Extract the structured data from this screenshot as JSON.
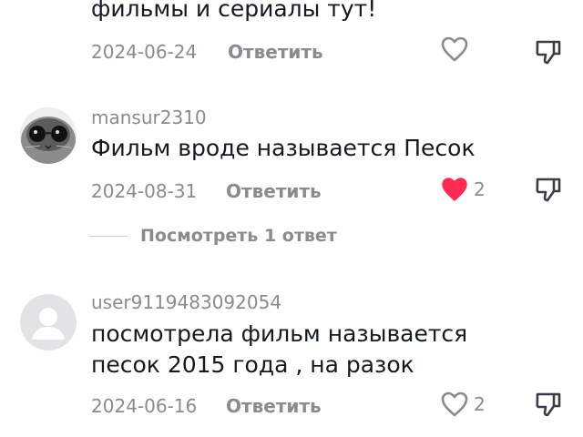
{
  "comments": [
    {
      "text": "фильмы и сериалы тут!",
      "date": "2024-06-24",
      "reply_label": "Ответить",
      "likes": "",
      "liked": false
    },
    {
      "username": "mansur2310",
      "text": "Фильм вроде называется Песок",
      "date": "2024-08-31",
      "reply_label": "Ответить",
      "likes": "2",
      "liked": true,
      "avatar_icon": "cat-with-glasses-avatar",
      "view_replies_label": "Посмотреть 1 ответ"
    },
    {
      "username": "user9119483092054",
      "text_line1": "посмотрела фильм называется",
      "text_line2": "песок 2015 года , на разок",
      "date": "2024-06-16",
      "reply_label": "Ответить",
      "likes": "2",
      "liked": false,
      "avatar_icon": "default-user-avatar"
    }
  ],
  "colors": {
    "text": "#161823",
    "muted": "#8a8b91",
    "like_active": "#fe2c55"
  }
}
